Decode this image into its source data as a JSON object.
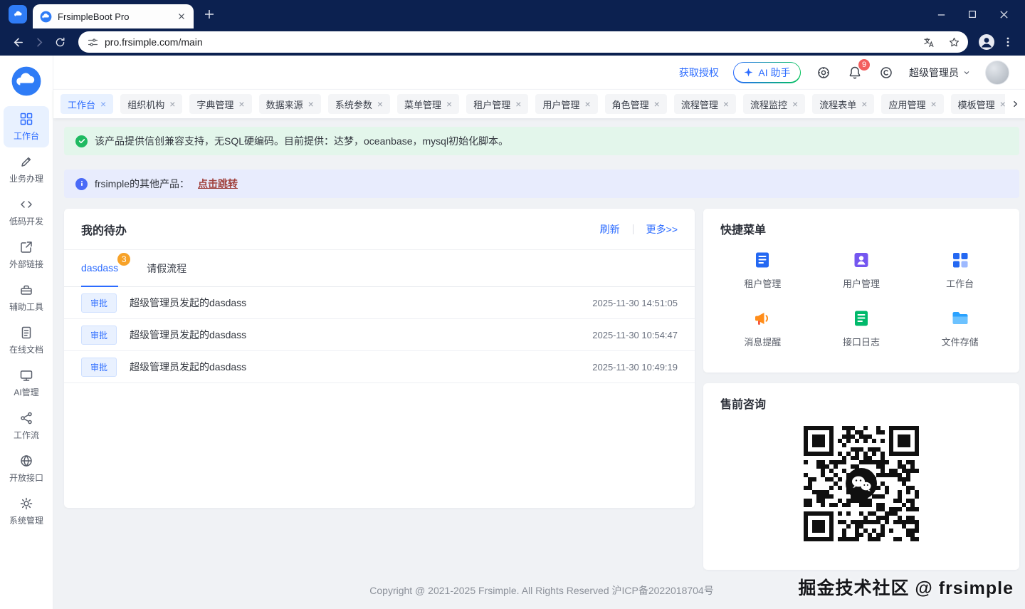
{
  "browser": {
    "tab_title": "FrsimpleBoot Pro",
    "url": "pro.frsimple.com/main"
  },
  "header": {
    "get_auth": "获取授权",
    "ai_assistant": "AI 助手",
    "notification_count": "9",
    "username": "超级管理员"
  },
  "sidebar": {
    "active": "工作台",
    "items": [
      {
        "label": "工作台"
      },
      {
        "label": "业务办理"
      },
      {
        "label": "低码开发"
      },
      {
        "label": "外部链接"
      },
      {
        "label": "辅助工具"
      },
      {
        "label": "在线文档"
      },
      {
        "label": "AI管理"
      },
      {
        "label": "工作流"
      },
      {
        "label": "开放接口"
      },
      {
        "label": "系统管理"
      }
    ]
  },
  "tabs": {
    "active": "工作台",
    "items": [
      "工作台",
      "组织机构",
      "字典管理",
      "数据来源",
      "系统参数",
      "菜单管理",
      "租户管理",
      "用户管理",
      "角色管理",
      "流程管理",
      "流程监控",
      "流程表单",
      "应用管理",
      "模板管理"
    ]
  },
  "alerts": {
    "success": "该产品提供信创兼容支持，无SQL硬编码。目前提供：达梦，oceanbase，mysql初始化脚本。",
    "info_prefix": "frsimple的其他产品：",
    "info_link": "点击跳转"
  },
  "todo": {
    "title": "我的待办",
    "refresh_label": "刷新",
    "more_label": "更多>>",
    "tabs": [
      {
        "label": "dasdass",
        "badge": "3"
      },
      {
        "label": "请假流程"
      }
    ],
    "rows": [
      {
        "action": "审批",
        "text": "超级管理员发起的dasdass",
        "time": "2025-11-30 14:51:05"
      },
      {
        "action": "审批",
        "text": "超级管理员发起的dasdass",
        "time": "2025-11-30 10:54:47"
      },
      {
        "action": "审批",
        "text": "超级管理员发起的dasdass",
        "time": "2025-11-30 10:49:19"
      }
    ]
  },
  "quick_menu": {
    "title": "快捷菜单",
    "items": [
      {
        "label": "租户管理",
        "icon": "tenant-icon",
        "color": "#2468f2"
      },
      {
        "label": "用户管理",
        "icon": "user-icon",
        "color": "#7456f0"
      },
      {
        "label": "工作台",
        "icon": "workbench-icon",
        "color": "#2468f2"
      },
      {
        "label": "消息提醒",
        "icon": "megaphone-icon",
        "color": "#ff8d1a"
      },
      {
        "label": "接口日志",
        "icon": "api-log-icon",
        "color": "#00b96b"
      },
      {
        "label": "文件存储",
        "icon": "folder-icon",
        "color": "#2aa2ff"
      }
    ]
  },
  "consult": {
    "title": "售前咨询"
  },
  "footer": {
    "text": "Copyright @ 2021-2025 Frsimple. All Rights Reserved 沪ICP备2022018704号"
  },
  "watermark": {
    "text": "掘金技术社区 @ frsimple"
  },
  "colors": {
    "accent": "#2b6bff",
    "browser_navy": "#0c2150",
    "success": "#1fba61",
    "info": "#4a6af7",
    "badge_orange": "#f7a228",
    "badge_red": "#f35d5d",
    "link_maroon": "#a0403c",
    "active_tab_bg": "#e8f1ff"
  }
}
